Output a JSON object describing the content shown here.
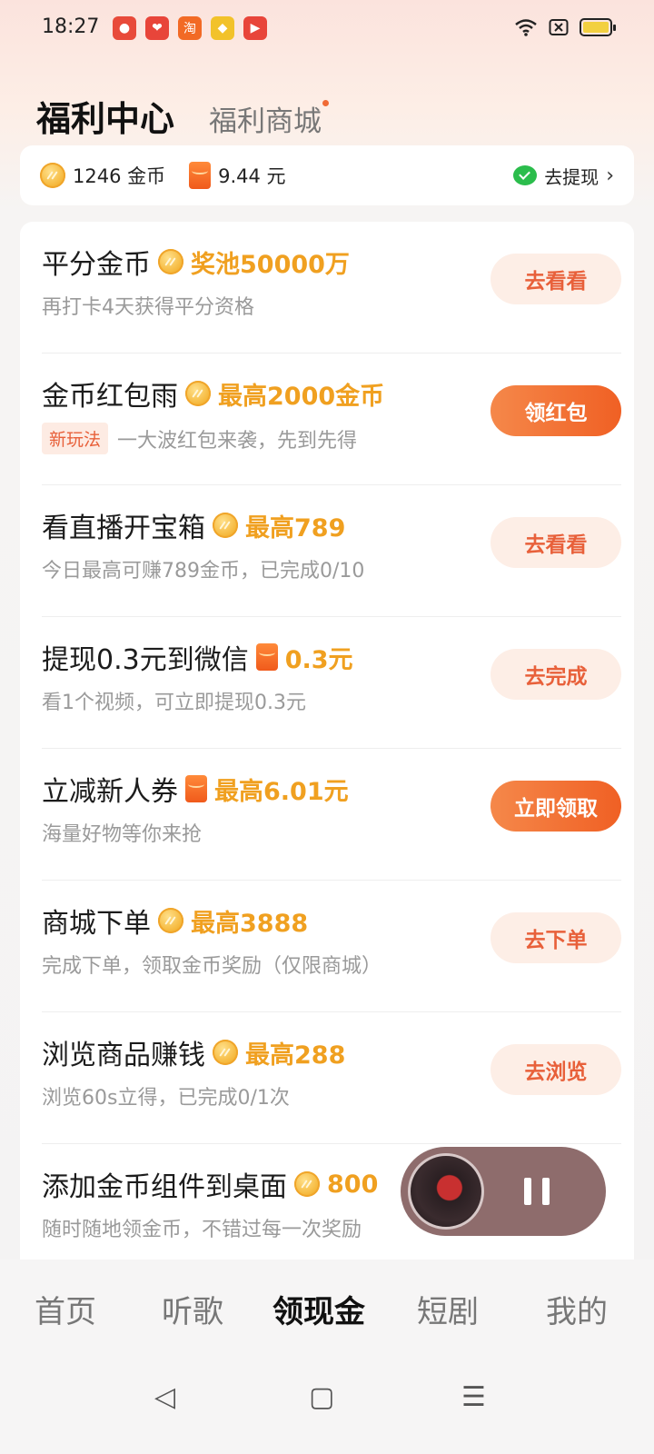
{
  "status_bar": {
    "time": "18:27",
    "app_icons": [
      {
        "name": "tomato-app-icon",
        "color": "#e84a3a",
        "glyph": "●"
      },
      {
        "name": "heart-app-icon",
        "color": "#e8453a",
        "glyph": "❤"
      },
      {
        "name": "taobao-app-icon",
        "color": "#f26a25",
        "glyph": "淘"
      },
      {
        "name": "shield-app-icon",
        "color": "#f2c22a",
        "glyph": "◆"
      },
      {
        "name": "play-app-icon",
        "color": "#e8453a",
        "glyph": "▶"
      }
    ]
  },
  "header": {
    "tab_active": "福利中心",
    "tab_inactive": "福利商城"
  },
  "balance": {
    "coins": "1246 金币",
    "cash": "9.44 元",
    "withdraw_label": "去提现",
    "chevron": "›"
  },
  "tasks": [
    {
      "title": "平分金币",
      "reward_icon": "coin",
      "reward": "奖池50000万",
      "badge": "",
      "sub": "再打卡4天获得平分资格",
      "button": "去看看",
      "button_style": "light"
    },
    {
      "title": "金币红包雨",
      "reward_icon": "coin",
      "reward": "最高2000金币",
      "badge": "新玩法",
      "sub": "一大波红包来袭，先到先得",
      "button": "领红包",
      "button_style": "solid"
    },
    {
      "title": "看直播开宝箱",
      "reward_icon": "coin",
      "reward": "最高789",
      "badge": "",
      "sub": "今日最高可赚789金币，已完成0/10",
      "button": "去看看",
      "button_style": "light"
    },
    {
      "title": "提现0.3元到微信",
      "reward_icon": "redpack",
      "reward": "0.3元",
      "badge": "",
      "sub": "看1个视频，可立即提现0.3元",
      "button": "去完成",
      "button_style": "light"
    },
    {
      "title": "立减新人券",
      "reward_icon": "redpack",
      "reward": "最高6.01元",
      "badge": "",
      "sub": "海量好物等你来抢",
      "button": "立即领取",
      "button_style": "solid"
    },
    {
      "title": "商城下单",
      "reward_icon": "coin",
      "reward": "最高3888",
      "badge": "",
      "sub": "完成下单，领取金币奖励（仅限商城）",
      "button": "去下单",
      "button_style": "light"
    },
    {
      "title": "浏览商品赚钱",
      "reward_icon": "coin",
      "reward": "最高288",
      "badge": "",
      "sub": "浏览60s立得，已完成0/1次",
      "button": "去浏览",
      "button_style": "light"
    },
    {
      "title": "添加金币组件到桌面",
      "reward_icon": "coin",
      "reward": "800",
      "badge": "",
      "sub": "随时随地领金币，不错过每一次奖励",
      "button": "",
      "button_style": "none"
    }
  ],
  "bottom_nav": [
    {
      "label": "首页",
      "active": false
    },
    {
      "label": "听歌",
      "active": false
    },
    {
      "label": "领现金",
      "active": true
    },
    {
      "label": "短剧",
      "active": false
    },
    {
      "label": "我的",
      "active": false
    }
  ],
  "system_nav": {
    "back": "◁",
    "home": "▢",
    "menu": "☰"
  },
  "colors": {
    "accent": "#f06024",
    "reward": "#f0a020",
    "button_light_bg": "#fdeee6"
  }
}
